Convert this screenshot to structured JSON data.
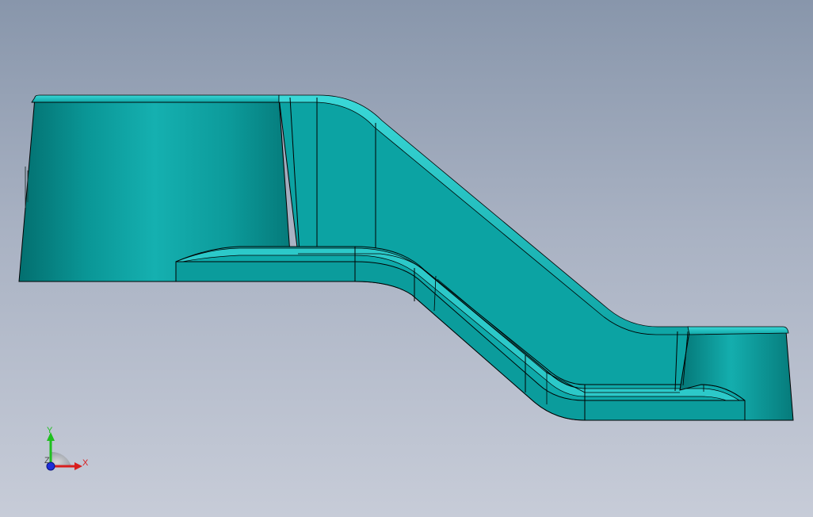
{
  "viewport": {
    "background_top": "#8896ab",
    "background_bottom": "#c7ccd8"
  },
  "model": {
    "part_color": "#0fa5a5",
    "edge_color": "#000000"
  },
  "triad": {
    "x_label": "X",
    "y_label": "Y",
    "z_label": "Z",
    "x_color": "#d81e1e",
    "y_color": "#1fbf1f",
    "z_color": "#1e2fd8"
  }
}
